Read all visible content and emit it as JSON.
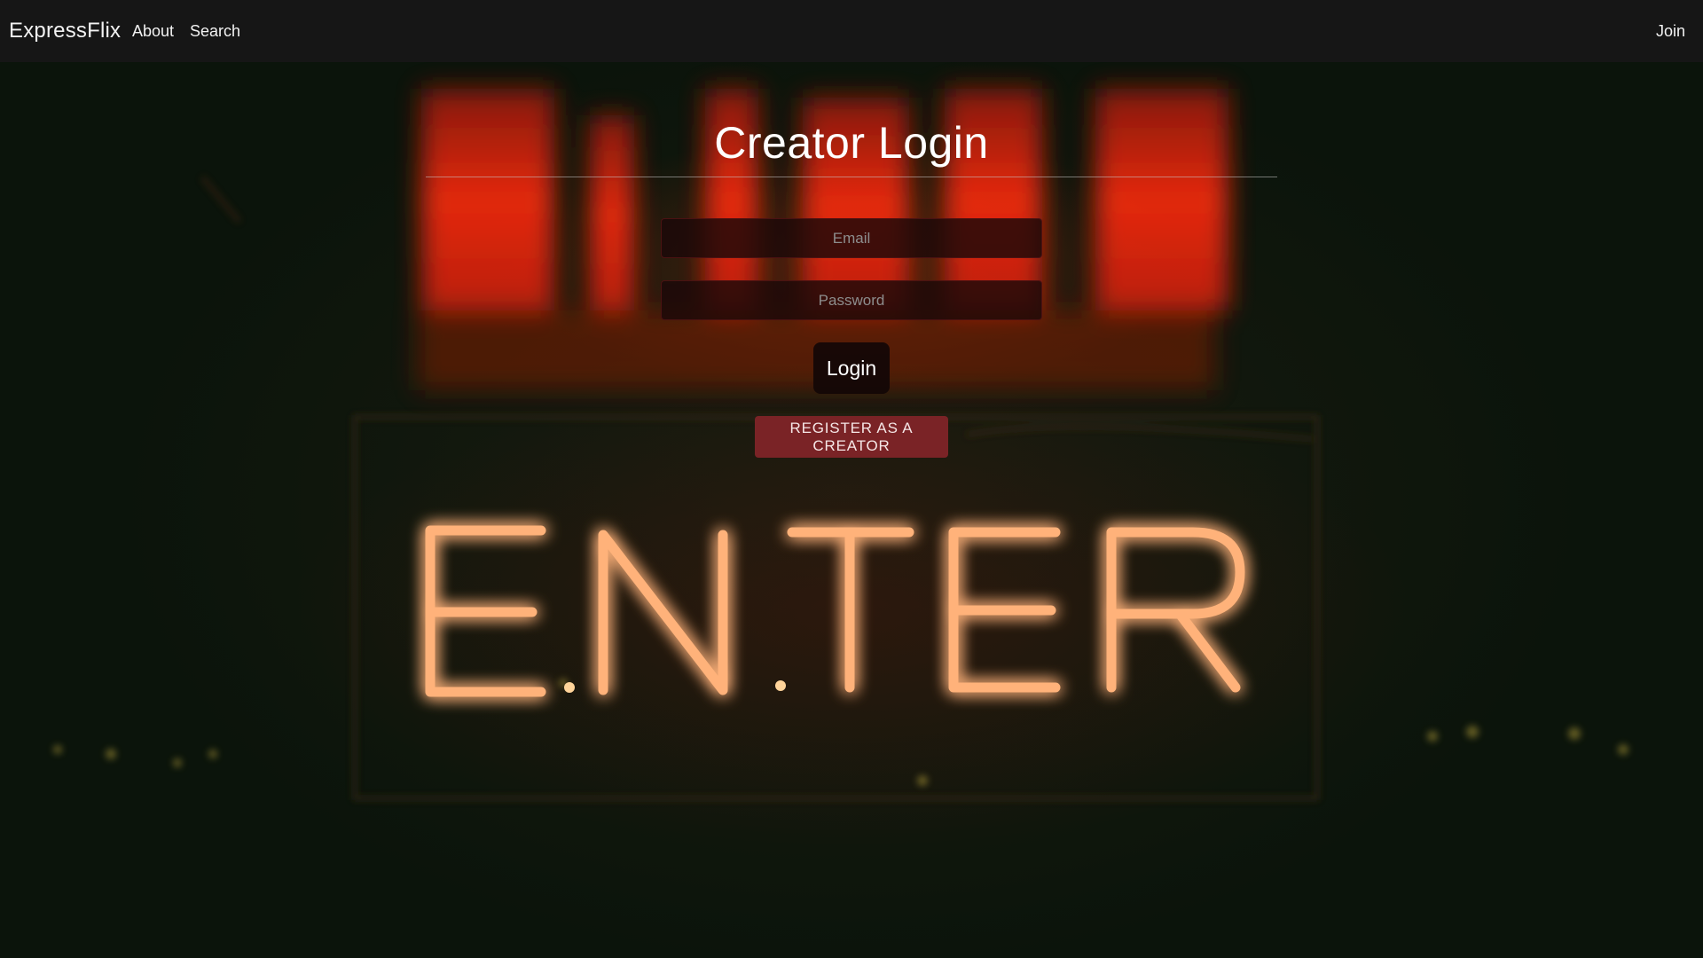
{
  "navbar": {
    "brand": "ExpressFlix",
    "links": [
      "About",
      "Search"
    ],
    "join_label": "Join"
  },
  "login": {
    "title": "Creator Login",
    "email_placeholder": "Email",
    "password_placeholder": "Password",
    "login_label": "Login",
    "register_label": "REGISTER AS A CREATOR"
  },
  "background": {
    "sign_text": "ENTER",
    "neon_color": "#ffb27a",
    "glow_color": "#ff3a10"
  }
}
